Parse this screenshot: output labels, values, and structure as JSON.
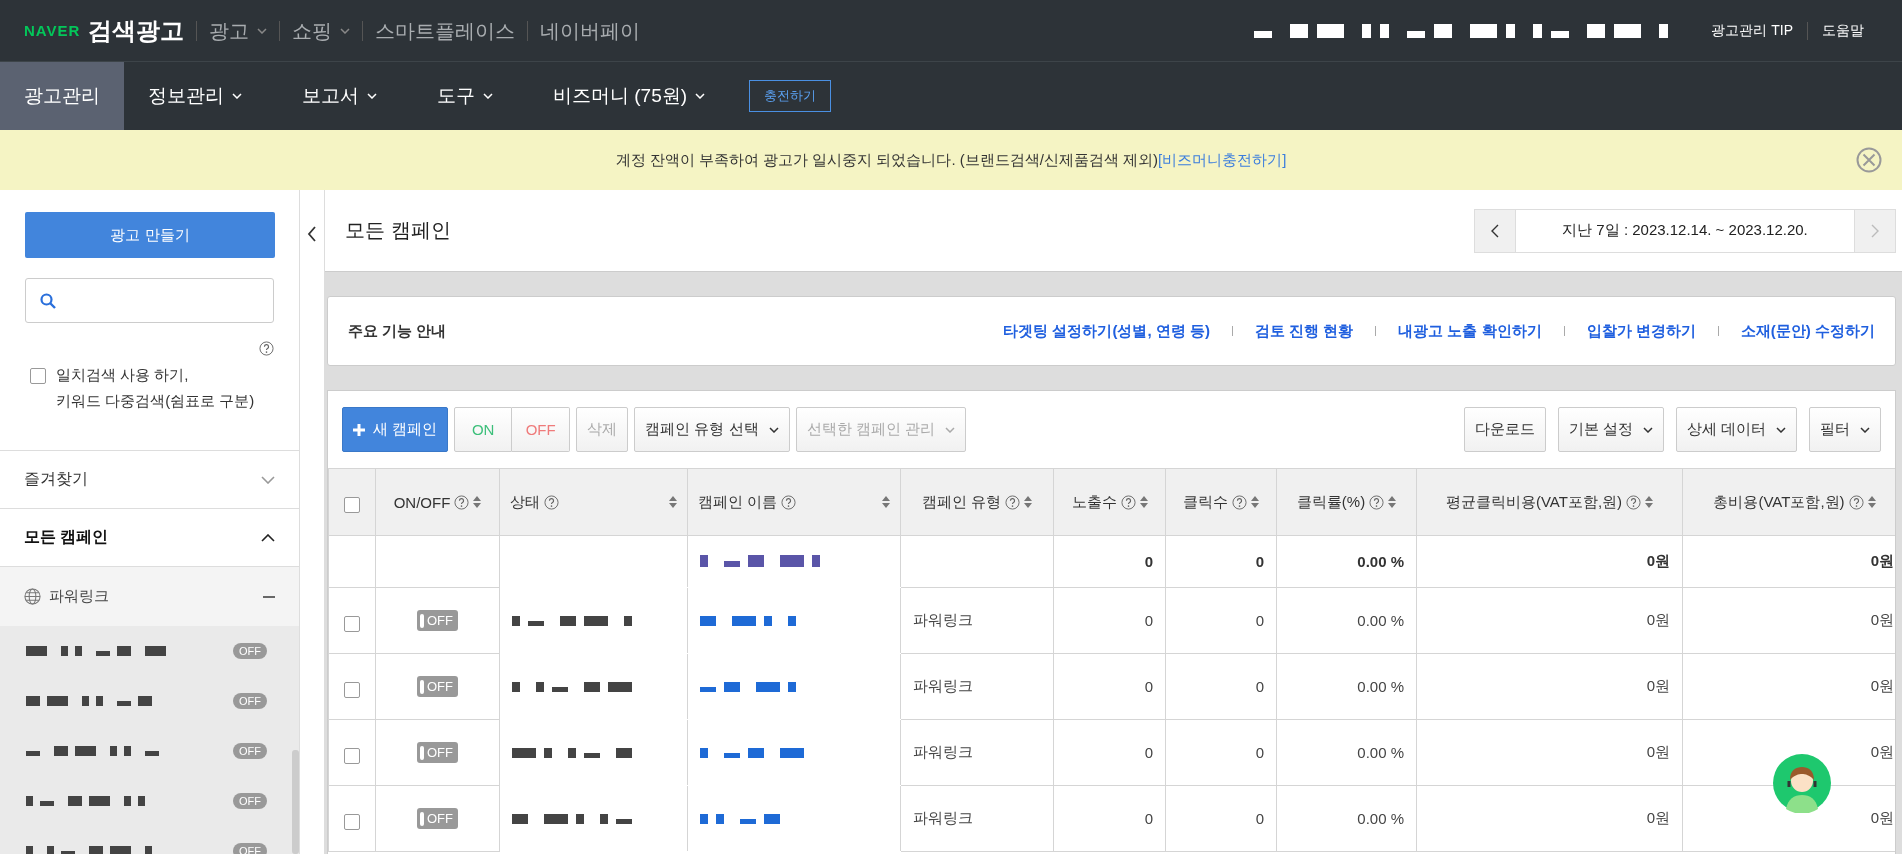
{
  "topbar": {
    "logo_brand": "NAVER",
    "logo_title": "검색광고",
    "menus": [
      {
        "label": "광고",
        "dropdown": true
      },
      {
        "label": "쇼핑",
        "dropdown": true
      },
      {
        "label": "스마트플레이스",
        "dropdown": false
      },
      {
        "label": "네이버페이",
        "dropdown": false
      }
    ],
    "links": [
      "광고관리 TIP",
      "도움말"
    ]
  },
  "nav": {
    "items": [
      {
        "label": "광고관리",
        "selected": true,
        "dropdown": false
      },
      {
        "label": "정보관리",
        "selected": false,
        "dropdown": true
      },
      {
        "label": "보고서",
        "selected": false,
        "dropdown": true
      },
      {
        "label": "도구",
        "selected": false,
        "dropdown": true
      },
      {
        "label": "비즈머니 (75원)",
        "selected": false,
        "dropdown": true
      }
    ],
    "charge_button": "충전하기"
  },
  "notice": {
    "message": "계정 잔액이 부족하여 광고가 일시중지 되었습니다. (브랜드검색/신제품검색 제외)",
    "link": "[비즈머니충전하기]"
  },
  "sidebar": {
    "create_button": "광고 만들기",
    "exact_search": {
      "label": "일치검색 사용 하기,\n키워드 다중검색(쉼표로 구분)",
      "checked": false
    },
    "sections": [
      {
        "label": "즐겨찾기",
        "expanded": false
      },
      {
        "label": "모든 캠페인",
        "expanded": true
      }
    ],
    "group": {
      "label": "파워링크",
      "expanded": true
    },
    "campaigns": [
      {
        "toggle": "OFF",
        "on": false
      },
      {
        "toggle": "OFF",
        "on": false
      },
      {
        "toggle": "OFF",
        "on": false
      },
      {
        "toggle": "OFF",
        "on": false
      },
      {
        "toggle": "OFF",
        "on": false
      }
    ]
  },
  "main": {
    "title": "모든 캠페인",
    "date_range": "지난 7일 : 2023.12.14. ~ 2023.12.20.",
    "guide": {
      "title": "주요 기능 안내",
      "links": [
        "타겟팅 설정하기(성별, 연령 등)",
        "검토 진행 현황",
        "내광고 노출 확인하기",
        "입찰가 변경하기",
        "소재(문안) 수정하기"
      ]
    },
    "toolbar": {
      "new_button": "새 캠페인",
      "on_button": {
        "label": "ON",
        "disabled": false
      },
      "off_button": {
        "label": "OFF",
        "disabled": false
      },
      "delete_button": {
        "label": "삭제",
        "disabled": true
      },
      "type_select": {
        "label": "캠페인 유형 선택",
        "disabled": false
      },
      "manage_select": {
        "label": "선택한 캠페인 관리",
        "disabled": true
      },
      "right": [
        {
          "label": "다운로드",
          "dropdown": false
        },
        {
          "label": "기본 설정",
          "dropdown": true
        },
        {
          "label": "상세 데이터",
          "dropdown": true
        },
        {
          "label": "필터",
          "dropdown": true
        }
      ]
    },
    "table": {
      "select_all": {
        "checked": false
      },
      "columns": [
        {
          "label": "ON/OFF"
        },
        {
          "label": "상태"
        },
        {
          "label": "캠페인 이름"
        },
        {
          "label": "캠페인 유형"
        },
        {
          "label": "노출수"
        },
        {
          "label": "클릭수"
        },
        {
          "label": "클릭률(%)"
        },
        {
          "label": "평균클릭비용(VAT포함,원)"
        },
        {
          "label": "총비용(VAT포함,원)"
        }
      ],
      "summary": {
        "impressions": "0",
        "clicks": "0",
        "ctr": "0.00 %",
        "cpc": "0원",
        "cost": "0원"
      },
      "rows": [
        {
          "checked": false,
          "on": false,
          "toggle": "OFF",
          "type": "파워링크",
          "impressions": "0",
          "clicks": "0",
          "ctr": "0.00 %",
          "cpc": "0원",
          "cost": "0원"
        },
        {
          "checked": false,
          "on": false,
          "toggle": "OFF",
          "type": "파워링크",
          "impressions": "0",
          "clicks": "0",
          "ctr": "0.00 %",
          "cpc": "0원",
          "cost": "0원"
        },
        {
          "checked": false,
          "on": false,
          "toggle": "OFF",
          "type": "파워링크",
          "impressions": "0",
          "clicks": "0",
          "ctr": "0.00 %",
          "cpc": "0원",
          "cost": "0원"
        },
        {
          "checked": false,
          "on": false,
          "toggle": "OFF",
          "type": "파워링크",
          "impressions": "0",
          "clicks": "0",
          "ctr": "0.00 %",
          "cpc": "0원",
          "cost": "0원"
        }
      ]
    }
  }
}
